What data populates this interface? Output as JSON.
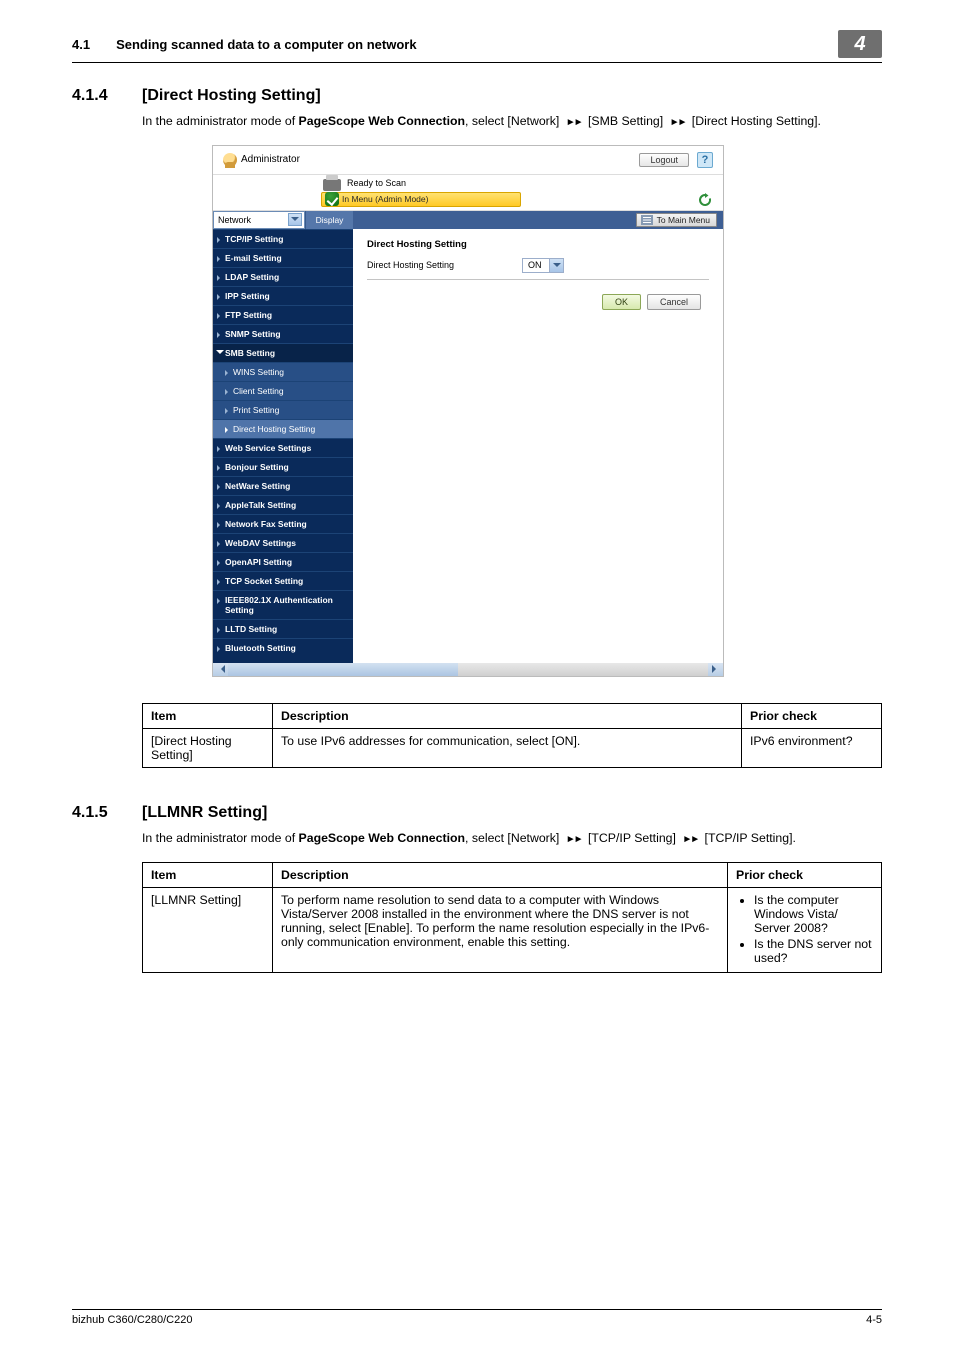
{
  "header": {
    "section_num": "4.1",
    "section_title": "Sending scanned data to a computer on network",
    "chapter_badge": "4"
  },
  "sec1": {
    "num": "4.1.4",
    "title": "[Direct Hosting Setting]",
    "intro_pre": "In the administrator mode of ",
    "intro_bold": "PageScope Web Connection",
    "intro_mid1": ", select [Network] ",
    "intro_mid2": " [SMB Setting] ",
    "intro_post": " [Direct Hosting Setting]."
  },
  "screenshot": {
    "admin_label": "Administrator",
    "logout": "Logout",
    "help": "?",
    "ready": "Ready to Scan",
    "mode": "In Menu (Admin Mode)",
    "nav_select": "Network",
    "display_btn": "Display",
    "to_main_menu": "To Main Menu",
    "nav": {
      "tcpip": "TCP/IP Setting",
      "email": "E-mail Setting",
      "ldap": "LDAP Setting",
      "ipp": "IPP Setting",
      "ftp": "FTP Setting",
      "snmp": "SNMP Setting",
      "smb": "SMB Setting",
      "wins": "WINS Setting",
      "client": "Client Setting",
      "print": "Print Setting",
      "dhs": "Direct Hosting Setting",
      "websvc": "Web Service Settings",
      "bonjour": "Bonjour Setting",
      "netware": "NetWare Setting",
      "appletalk": "AppleTalk Setting",
      "netfax": "Network Fax Setting",
      "webdav": "WebDAV Settings",
      "openapi": "OpenAPI Setting",
      "tcpsock": "TCP Socket Setting",
      "ieee": "IEEE802.1X Authentication Setting",
      "lltd": "LLTD Setting",
      "bluetooth": "Bluetooth Setting"
    },
    "content_heading": "Direct Hosting Setting",
    "content_row_label": "Direct Hosting Setting",
    "content_select_value": "ON",
    "ok": "OK",
    "cancel": "Cancel"
  },
  "table1": {
    "h_item": "Item",
    "h_desc": "Description",
    "h_prior": "Prior check",
    "r1_item": "[Direct Hosting Setting]",
    "r1_desc": "To use IPv6 addresses for communication, select [ON].",
    "r1_prior": "IPv6 environment?"
  },
  "sec2": {
    "num": "4.1.5",
    "title": "[LLMNR Setting]",
    "intro_pre": "In the administrator mode of ",
    "intro_bold": "PageScope Web Connection",
    "intro_mid1": ", select [Network] ",
    "intro_mid2": " [TCP/IP Setting] ",
    "intro_post": " [TCP/IP Setting]."
  },
  "table2": {
    "h_item": "Item",
    "h_desc": "Description",
    "h_prior": "Prior check",
    "r1_item": "[LLMNR Setting]",
    "r1_desc": "To perform name resolution to send data to a computer with Windows Vista/Server 2008 installed in the environment where the DNS server is not running, select [Enable]. To perform the name resolution especially in the IPv6-only communication environment, enable this setting.",
    "r1_p1": "Is the computer Windows Vista/ Server 2008?",
    "r1_p2": "Is the DNS server not used?"
  },
  "footer": {
    "left": "bizhub C360/C280/C220",
    "right": "4-5"
  }
}
